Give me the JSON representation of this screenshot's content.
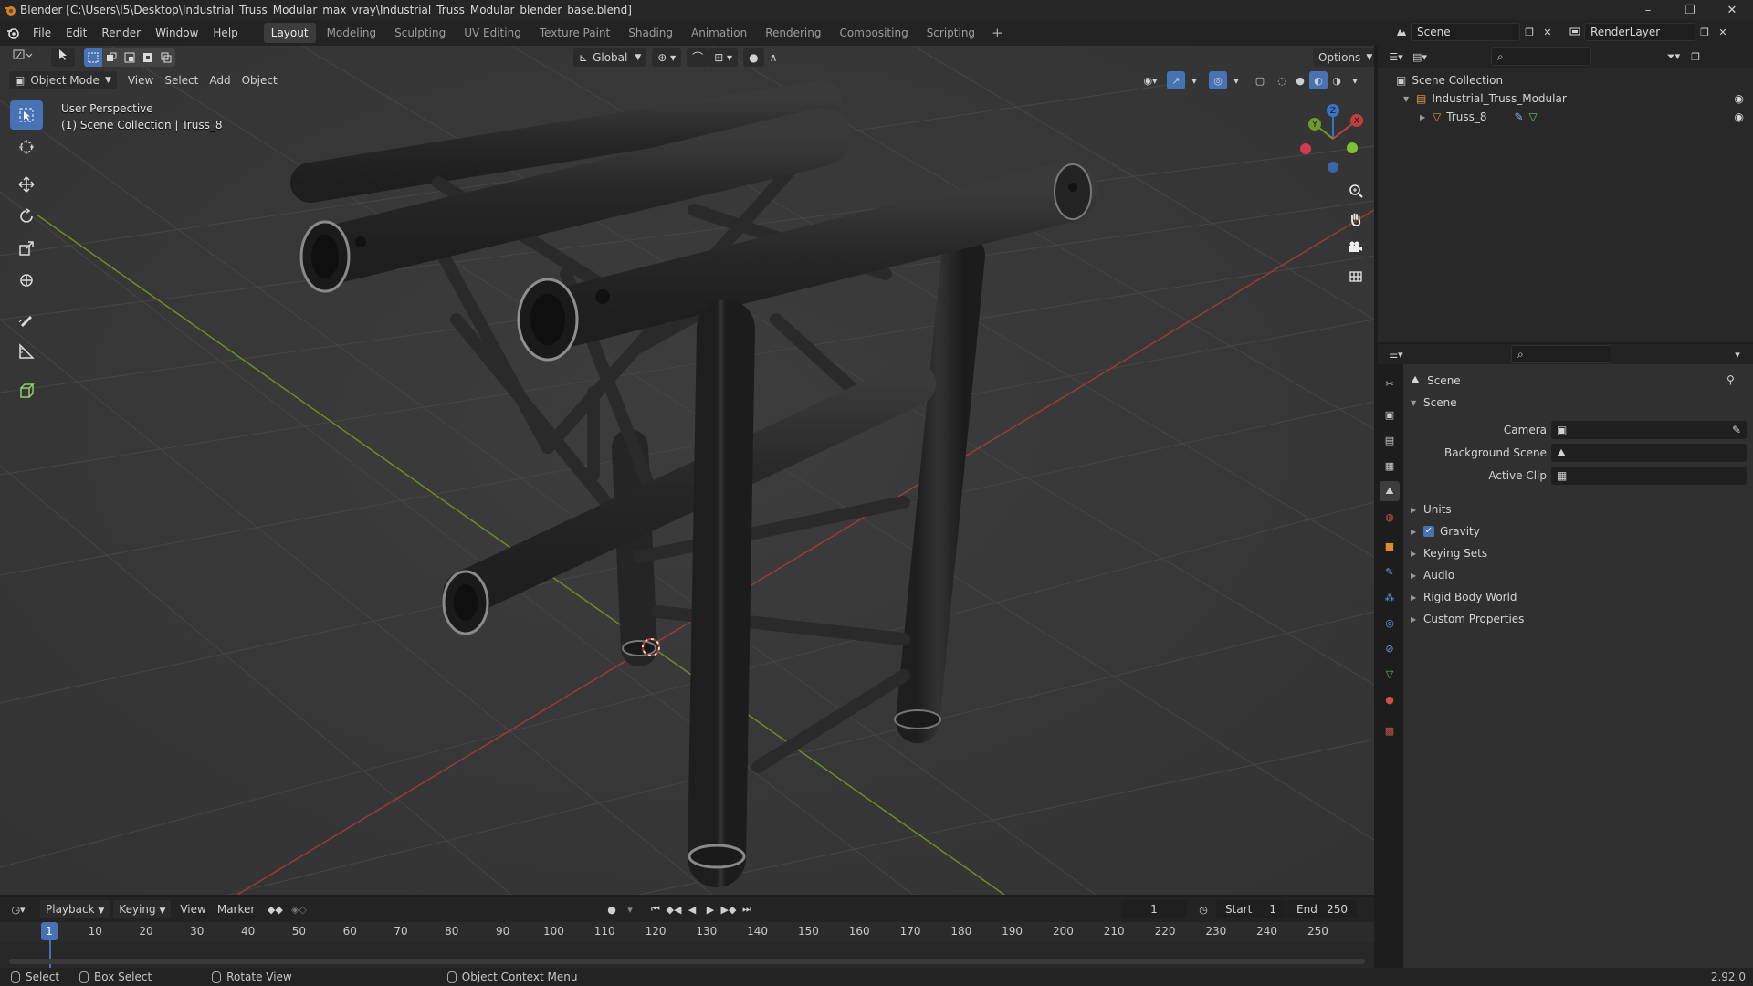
{
  "window": {
    "title": "Blender [C:\\Users\\I5\\Desktop\\Industrial_Truss_Modular_max_vray\\Industrial_Truss_Modular_blender_base.blend]",
    "controls": [
      "–",
      "❐",
      "✕"
    ]
  },
  "menu": [
    "File",
    "Edit",
    "Render",
    "Window",
    "Help"
  ],
  "workspaces": {
    "tabs": [
      "Layout",
      "Modeling",
      "Sculpting",
      "UV Editing",
      "Texture Paint",
      "Shading",
      "Animation",
      "Rendering",
      "Compositing",
      "Scripting"
    ],
    "active": "Layout"
  },
  "top_right": {
    "scene": "Scene",
    "view_layer": "RenderLayer"
  },
  "viewport": {
    "transform_orientation": "Global",
    "options_label": "Options",
    "mode": "Object Mode",
    "header_menu": [
      "View",
      "Select",
      "Add",
      "Object"
    ],
    "perspective_label": "User Perspective",
    "collection_label": "(1) Scene Collection | Truss_8",
    "tools": [
      "select-box-icon",
      "cursor-icon",
      "move-icon",
      "rotate-icon",
      "scale-icon",
      "transform-icon",
      "annotate-icon",
      "measure-icon",
      "add-cube-icon"
    ],
    "gizmo": {
      "x": "X",
      "y": "Y",
      "z": "Z"
    },
    "colors": {
      "background": "#393939",
      "grid": "#454545",
      "x_axis": "#9a3a3a",
      "y_axis": "#6e8b2a",
      "truss": "#2c2c2c"
    }
  },
  "outliner": {
    "root": "Scene Collection",
    "items": [
      {
        "label": "Industrial_Truss_Modular",
        "type": "collection"
      },
      {
        "label": "Truss_8",
        "type": "object"
      }
    ]
  },
  "properties": {
    "breadcrumb": "Scene",
    "section": "Scene",
    "fields": [
      {
        "label": "Camera",
        "value": ""
      },
      {
        "label": "Background Scene",
        "value": ""
      },
      {
        "label": "Active Clip",
        "value": ""
      }
    ],
    "panels": [
      {
        "label": "Units",
        "checkbox": false
      },
      {
        "label": "Gravity",
        "checkbox": true
      },
      {
        "label": "Keying Sets",
        "checkbox": false
      },
      {
        "label": "Audio",
        "checkbox": false
      },
      {
        "label": "Rigid Body World",
        "checkbox": false
      },
      {
        "label": "Custom Properties",
        "checkbox": false
      }
    ]
  },
  "timeline": {
    "menu": [
      "Playback",
      "Keying",
      "View",
      "Marker"
    ],
    "current_frame": "1",
    "start_label": "Start",
    "start": "1",
    "end_label": "End",
    "end": "250",
    "ruler": [
      "1",
      "10",
      "20",
      "30",
      "40",
      "50",
      "60",
      "70",
      "80",
      "90",
      "100",
      "110",
      "120",
      "130",
      "140",
      "150",
      "160",
      "170",
      "180",
      "190",
      "200",
      "210",
      "220",
      "230",
      "240",
      "250"
    ]
  },
  "statusbar": {
    "items": [
      "Select",
      "Box Select",
      "Rotate View",
      "Object Context Menu"
    ],
    "version": "2.92.0"
  }
}
